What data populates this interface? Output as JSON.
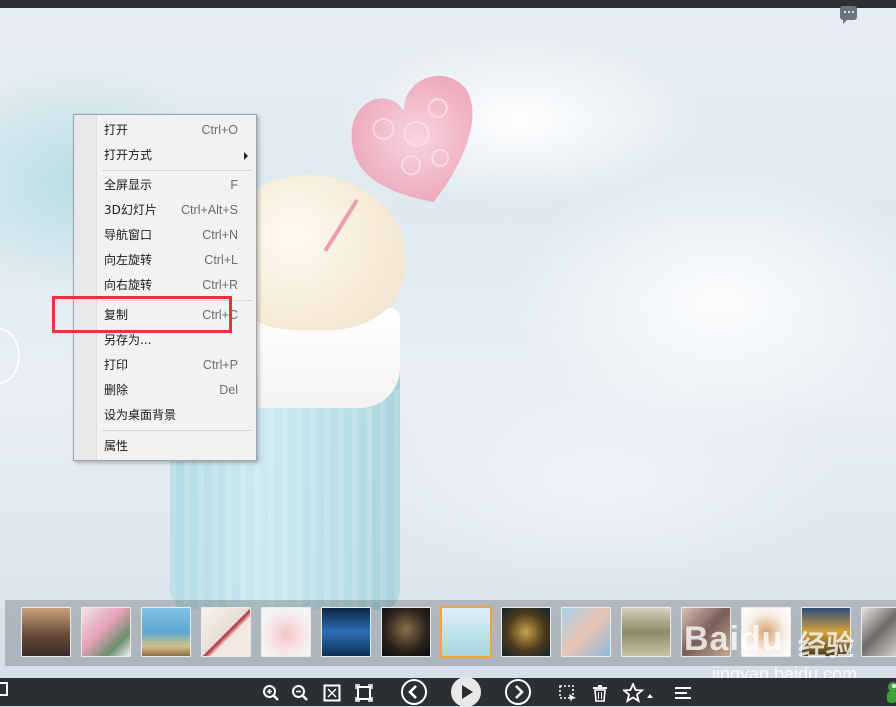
{
  "context_menu": {
    "items": [
      {
        "label": "打开",
        "shortcut": "Ctrl+O"
      },
      {
        "label": "打开方式",
        "shortcut": ""
      },
      {
        "label": "全屏显示",
        "shortcut": "F"
      },
      {
        "label": "3D幻灯片",
        "shortcut": "Ctrl+Alt+S"
      },
      {
        "label": "导航窗口",
        "shortcut": "Ctrl+N"
      },
      {
        "label": "向左旋转",
        "shortcut": "Ctrl+L"
      },
      {
        "label": "向右旋转",
        "shortcut": "Ctrl+R"
      },
      {
        "label": "复制",
        "shortcut": "Ctrl+C"
      },
      {
        "label": "另存为...",
        "shortcut": ""
      },
      {
        "label": "打印",
        "shortcut": "Ctrl+P"
      },
      {
        "label": "删除",
        "shortcut": "Del"
      },
      {
        "label": "设为桌面背景",
        "shortcut": ""
      },
      {
        "label": "属性",
        "shortcut": ""
      }
    ]
  },
  "colors": {
    "highlight": "#e8333a",
    "selected_thumb": "#f1a43a",
    "toolbar_bg": "#2b2e32"
  },
  "thumbnails": {
    "count": 15,
    "selected_index": 7
  },
  "toolbar": {
    "icons": [
      "zoom-in-icon",
      "zoom-out-icon",
      "fit-icon",
      "actual-size-icon",
      "prev-icon",
      "play-icon",
      "next-icon",
      "crop-icon",
      "trash-icon",
      "star-icon",
      "menu-icon"
    ]
  },
  "watermark": {
    "brand": "Baidu",
    "word": "经验",
    "url": "jingyan.baidu.com"
  }
}
